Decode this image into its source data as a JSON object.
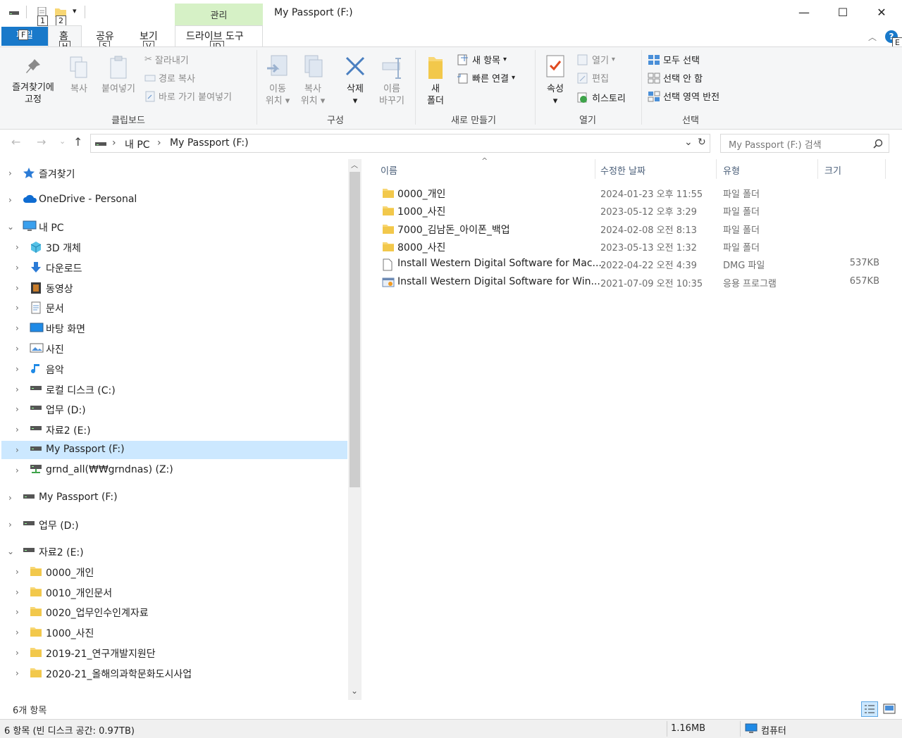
{
  "window": {
    "title": "My Passport (F:)",
    "context_tab_group": "관리",
    "minimize": "—",
    "maximize": "☐",
    "close": "✕"
  },
  "keytips": {
    "qat1": "1",
    "qat2": "2",
    "file": "F",
    "home": "H",
    "share": "S",
    "view": "V",
    "drive": "JD",
    "help": "E"
  },
  "tabs": {
    "file": "파일",
    "home": "홈",
    "share": "공유",
    "view": "보기",
    "drive_tools": "드라이브 도구"
  },
  "ribbon": {
    "clipboard": {
      "label": "클립보드",
      "pin_line1": "즐겨찾기에",
      "pin_line2": "고정",
      "copy": "복사",
      "paste": "붙여넣기",
      "cut": "잘라내기",
      "copy_path": "경로 복사",
      "paste_shortcut": "바로 가기 붙여넣기"
    },
    "organize": {
      "label": "구성",
      "move_line1": "이동",
      "move_line2": "위치",
      "copyto_line1": "복사",
      "copyto_line2": "위치",
      "delete": "삭제",
      "rename_line1": "이름",
      "rename_line2": "바꾸기"
    },
    "new": {
      "label": "새로 만들기",
      "folder_line1": "새",
      "folder_line2": "폴더",
      "new_item": "새 항목",
      "easy_access": "빠른 연결"
    },
    "open": {
      "label": "열기",
      "properties": "속성",
      "open": "열기",
      "edit": "편집",
      "history": "히스토리"
    },
    "select": {
      "label": "선택",
      "select_all": "모두 선택",
      "select_none": "선택 안 함",
      "invert": "선택 영역 반전"
    }
  },
  "address": {
    "this_pc": "내 PC",
    "current": "My Passport (F:)",
    "search_placeholder": "My Passport (F:) 검색"
  },
  "nav": {
    "items": [
      {
        "label": "즐겨찾기",
        "icon": "star-icon"
      },
      {
        "label": "OneDrive - Personal",
        "icon": "cloud-icon"
      },
      {
        "label": "내 PC",
        "icon": "pc-icon"
      },
      {
        "label": "3D 개체",
        "icon": "cube-icon"
      },
      {
        "label": "다운로드",
        "icon": "download-icon"
      },
      {
        "label": "동영상",
        "icon": "video-icon"
      },
      {
        "label": "문서",
        "icon": "document-icon"
      },
      {
        "label": "바탕 화면",
        "icon": "desktop-icon"
      },
      {
        "label": "사진",
        "icon": "pictures-icon"
      },
      {
        "label": "음악",
        "icon": "music-icon"
      },
      {
        "label": "로컬 디스크 (C:)",
        "icon": "drive-icon"
      },
      {
        "label": "업무 (D:)",
        "icon": "drive-icon"
      },
      {
        "label": "자료2 (E:)",
        "icon": "drive-icon"
      },
      {
        "label": "My Passport (F:)",
        "icon": "drive-icon"
      },
      {
        "label": "grnd_all(₩₩grndnas) (Z:)",
        "icon": "network-drive-icon"
      },
      {
        "label": "My Passport (F:)",
        "icon": "drive-icon"
      },
      {
        "label": "업무 (D:)",
        "icon": "drive-icon"
      },
      {
        "label": "자료2 (E:)",
        "icon": "drive-icon"
      },
      {
        "label": "0000_개인",
        "icon": "folder-icon"
      },
      {
        "label": "0010_개인문서",
        "icon": "folder-icon"
      },
      {
        "label": "0020_업무인수인계자료",
        "icon": "folder-icon"
      },
      {
        "label": "1000_사진",
        "icon": "folder-icon"
      },
      {
        "label": "2019-21_연구개발지원단",
        "icon": "folder-icon"
      },
      {
        "label": "2020-21_올해의과학문화도시사업",
        "icon": "folder-icon"
      }
    ]
  },
  "columns": {
    "name": "이름",
    "date": "수정한 날짜",
    "type": "유형",
    "size": "크기"
  },
  "files": [
    {
      "name": "0000_개인",
      "date": "2024-01-23 오후 11:55",
      "type": "파일 폴더",
      "size": "",
      "icon": "folder-icon"
    },
    {
      "name": "1000_사진",
      "date": "2023-05-12 오후 3:29",
      "type": "파일 폴더",
      "size": "",
      "icon": "folder-icon"
    },
    {
      "name": "7000_김남돈_아이폰_백업",
      "date": "2024-02-08 오전 8:13",
      "type": "파일 폴더",
      "size": "",
      "icon": "folder-icon"
    },
    {
      "name": "8000_사진",
      "date": "2023-05-13 오전 1:32",
      "type": "파일 폴더",
      "size": "",
      "icon": "folder-icon"
    },
    {
      "name": "Install Western Digital Software for Mac....",
      "date": "2022-04-22 오전 4:39",
      "type": "DMG 파일",
      "size": "537KB",
      "icon": "file-icon"
    },
    {
      "name": "Install Western Digital Software for Win...",
      "date": "2021-07-09 오전 10:35",
      "type": "응용 프로그램",
      "size": "657KB",
      "icon": "app-icon"
    }
  ],
  "status": {
    "item_count": "6개 항목",
    "summary": "6 항목 (빈 디스크 공간: 0.97TB)",
    "size": "1.16MB",
    "location": "컴퓨터"
  },
  "colors": {
    "accent": "#1979ca",
    "selection": "#cce8ff",
    "context_tab": "#d6f1c6",
    "folder": "#f8d775"
  }
}
